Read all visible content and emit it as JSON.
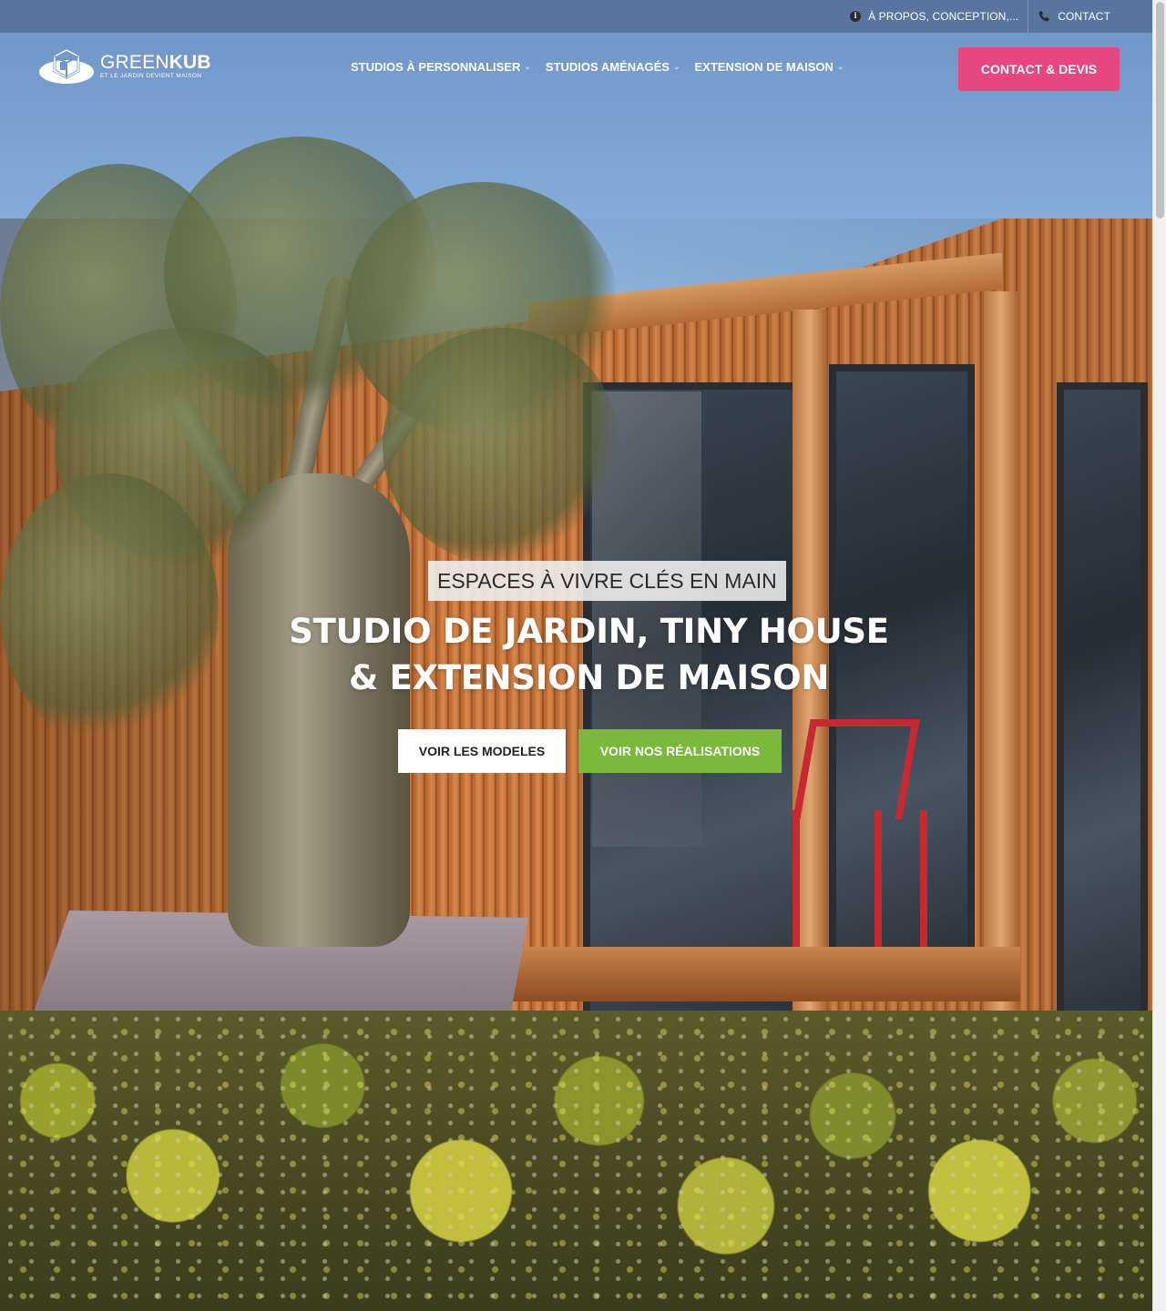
{
  "topbar": {
    "about_label": "À PROPOS, CONCEPTION,...",
    "contact_label": "CONTACT",
    "about_icon": "info-icon",
    "contact_icon": "phone-icon"
  },
  "logo": {
    "word_light": "GREEN",
    "word_bold": "KUB",
    "tagline": "ET LE JARDIN DEVIENT MAISON"
  },
  "nav": {
    "items": [
      {
        "label": "STUDIOS À PERSONNALISER"
      },
      {
        "label": "STUDIOS AMÉNAGÉS"
      },
      {
        "label": "EXTENSION DE MAISON"
      }
    ],
    "dropdown_icon": "chevron-down-icon"
  },
  "cta": {
    "label": "CONTACT & DEVIS",
    "color": "#e7467e"
  },
  "hero": {
    "kicker": "ESPACES À VIVRE CLÉS EN MAIN",
    "headline_line1": "STUDIO DE JARDIN, TINY HOUSE",
    "headline_line2": "& EXTENSION DE MAISON",
    "button_models": "VOIR LES MODELES",
    "button_realisations": "VOIR NOS RÉALISATIONS",
    "green_color": "#7ab93c"
  }
}
